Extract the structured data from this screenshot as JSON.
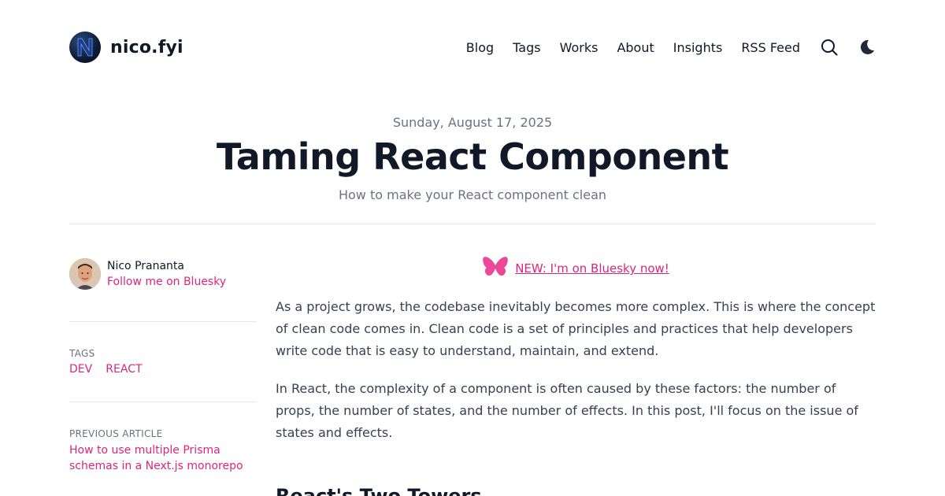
{
  "header": {
    "brand_name": "nico.fyi",
    "nav": [
      "Blog",
      "Tags",
      "Works",
      "About",
      "Insights",
      "RSS Feed"
    ],
    "icons": [
      "search-icon",
      "moon-icon"
    ]
  },
  "post": {
    "date": "Sunday, August 17, 2025",
    "title": "Taming React Component",
    "subtitle": "How to make your React component clean"
  },
  "sidebar": {
    "author_name": "Nico Prananta",
    "author_link": "Follow me on Bluesky",
    "tags_label": "TAGS",
    "tags": [
      "DEV",
      "REACT"
    ],
    "previous_label": "PREVIOUS ARTICLE",
    "previous_title_line1": "How to use multiple Prisma",
    "previous_title_line2": "schemas in a Next.js monorepo"
  },
  "article": {
    "bluesky_banner": "NEW: I'm on Bluesky now!",
    "paragraphs": [
      "As a project grows, the codebase inevitably becomes more complex. This is where the concept of clean code comes in. Clean code is a set of principles and practices that help developers write code that is easy to understand, maintain, and extend.",
      "In React, the complexity of a component is often caused by these factors: the number of props, the number of states, and the number of effects. In this post, I'll focus on the issue of states and effects."
    ],
    "section_heading": "React's Two Towers"
  },
  "colors": {
    "accent": "#db2777",
    "text": "#111827",
    "muted": "#6b7280",
    "divider": "#e5e7eb"
  }
}
